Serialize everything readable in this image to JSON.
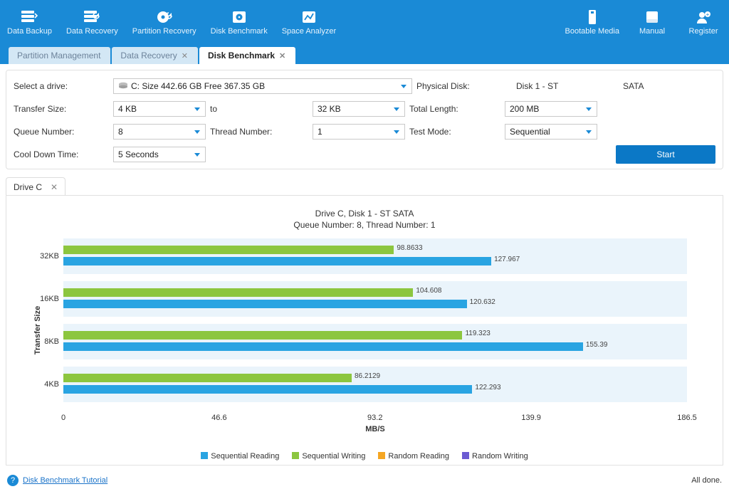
{
  "colors": {
    "accent": "#1a8ad6",
    "bar_blue": "#29a4e2",
    "bar_green": "#8cc63f",
    "bar_orange": "#f5a623",
    "bar_purple": "#6b5bd2"
  },
  "toolbar": {
    "left": [
      {
        "label": "Data Backup",
        "icon": "data-backup-icon"
      },
      {
        "label": "Data Recovery",
        "icon": "data-recovery-icon"
      },
      {
        "label": "Partition Recovery",
        "icon": "partition-recovery-icon"
      },
      {
        "label": "Disk Benchmark",
        "icon": "disk-benchmark-icon"
      },
      {
        "label": "Space Analyzer",
        "icon": "space-analyzer-icon"
      }
    ],
    "right": [
      {
        "label": "Bootable Media",
        "icon": "bootable-media-icon"
      },
      {
        "label": "Manual",
        "icon": "manual-icon"
      },
      {
        "label": "Register",
        "icon": "register-icon"
      }
    ]
  },
  "tabs": [
    {
      "label": "Partition Management",
      "closable": false,
      "active": false
    },
    {
      "label": "Data Recovery",
      "closable": true,
      "active": false
    },
    {
      "label": "Disk Benchmark",
      "closable": true,
      "active": true
    }
  ],
  "form": {
    "select_drive_label": "Select a drive:",
    "drive_value": "C:  Size 442.66 GB  Free 367.35 GB",
    "physical_disk_label": "Physical Disk:",
    "physical_disk_name": "Disk 1 - ST",
    "physical_disk_iface": "SATA",
    "transfer_size_label": "Transfer Size:",
    "transfer_from": "4 KB",
    "to_label": "to",
    "transfer_to": "32 KB",
    "total_length_label": "Total Length:",
    "total_length": "200 MB",
    "queue_label": "Queue Number:",
    "queue": "8",
    "thread_label": "Thread Number:",
    "thread": "1",
    "testmode_label": "Test Mode:",
    "testmode": "Sequential",
    "cooldown_label": "Cool Down Time:",
    "cooldown": "5 Seconds",
    "start_label": "Start"
  },
  "result_tab": {
    "label": "Drive C"
  },
  "chart_data": {
    "type": "bar",
    "orientation": "horizontal",
    "title": "Drive C, Disk 1 - ST                              SATA",
    "subtitle": "Queue Number: 8, Thread Number: 1",
    "xlabel": "MB/S",
    "ylabel": "Transfer Size",
    "xlim": [
      0,
      186.5
    ],
    "xticks": [
      0.0,
      46.6,
      93.2,
      139.9,
      186.5
    ],
    "categories": [
      "32KB",
      "16KB",
      "8KB",
      "4KB"
    ],
    "series": [
      {
        "name": "Sequential Reading",
        "color": "#29a4e2",
        "values": [
          127.967,
          120.632,
          155.39,
          122.293
        ]
      },
      {
        "name": "Sequential Writing",
        "color": "#8cc63f",
        "values": [
          98.8633,
          104.608,
          119.323,
          86.2129
        ]
      },
      {
        "name": "Random Reading",
        "color": "#f5a623",
        "values": [
          null,
          null,
          null,
          null
        ]
      },
      {
        "name": "Random Writing",
        "color": "#6b5bd2",
        "values": [
          null,
          null,
          null,
          null
        ]
      }
    ]
  },
  "footer": {
    "tutorial_link": "Disk Benchmark Tutorial",
    "status": "All done."
  }
}
